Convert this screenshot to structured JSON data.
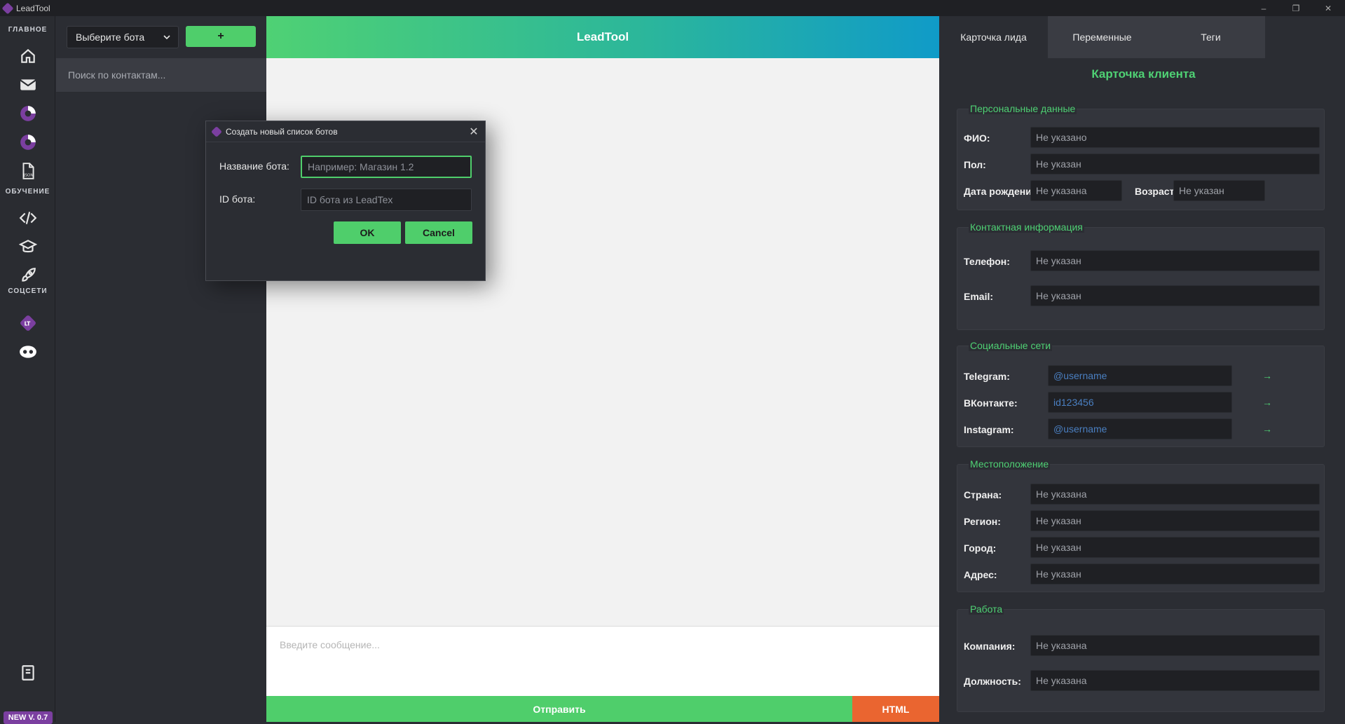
{
  "window": {
    "title": "LeadTool",
    "controls": [
      "minimize-icon",
      "restore-icon",
      "close-icon"
    ]
  },
  "sidebar": {
    "sections": [
      "ГЛАВНОЕ",
      "ОБУЧЕНИЕ",
      "СОЦСЕТИ"
    ],
    "main_icons": [
      "home-icon",
      "mail-icon",
      "chart-icon",
      "chart-alt-icon",
      "json-file-icon"
    ],
    "learning_icons": [
      "code-icon",
      "graduation-cap-icon",
      "rocket-icon"
    ],
    "social_icons": [
      "leadtex-logo-icon",
      "gamepad-icon"
    ],
    "bottom_icon": "notebook-icon",
    "version": "NEW V. 0.7"
  },
  "contacts": {
    "bot_select": "Выберите бота",
    "add_button": "+",
    "search_placeholder": "Поиск по контактам..."
  },
  "chat": {
    "header_title": "LeadTool",
    "input_placeholder": "Введите сообщение...",
    "send_label": "Отправить",
    "html_label": "HTML"
  },
  "right_panel": {
    "tabs": [
      "Карточка лида",
      "Переменные",
      "Теги"
    ],
    "card_title": "Карточка клиента",
    "personal": {
      "legend": "Персональные данные",
      "fio_label": "ФИО:",
      "fio_value": "Не указано",
      "gender_label": "Пол:",
      "gender_value": "Не указан",
      "birth_label": "Дата рождени",
      "birth_value": "Не указана",
      "age_label": "Возраст:",
      "age_value": "Не указан"
    },
    "contact": {
      "legend": "Контактная информация",
      "phone_label": "Телефон:",
      "phone_value": "Не указан",
      "email_label": "Email:",
      "email_value": "Не указан"
    },
    "social": {
      "legend": "Социальные сети",
      "telegram_label": "Telegram:",
      "telegram_value": "@username",
      "vk_label": "ВКонтакте:",
      "vk_value": "id123456",
      "instagram_label": "Instagram:",
      "instagram_value": "@username",
      "arrow": "→"
    },
    "location": {
      "legend": "Местоположение",
      "country_label": "Страна:",
      "country_value": "Не указана",
      "region_label": "Регион:",
      "region_value": "Не указан",
      "city_label": "Город:",
      "city_value": "Не указан",
      "address_label": "Адрес:",
      "address_value": "Не указан"
    },
    "work": {
      "legend": "Работа",
      "company_label": "Компания:",
      "company_value": "Не указана",
      "position_label": "Должность:",
      "position_value": "Не указана"
    }
  },
  "modal": {
    "title": "Создать новый список ботов",
    "name_label": "Название бота:",
    "name_placeholder": "Например: Магазин 1.2",
    "id_label": "ID бота:",
    "id_placeholder": "ID бота из LeadTex",
    "ok_label": "OK",
    "cancel_label": "Cancel"
  },
  "colors": {
    "accent_green": "#4fce6b",
    "accent_orange": "#ea6530",
    "brand_purple": "#7b3fa0",
    "header_gradient_end": "#109bc8"
  }
}
